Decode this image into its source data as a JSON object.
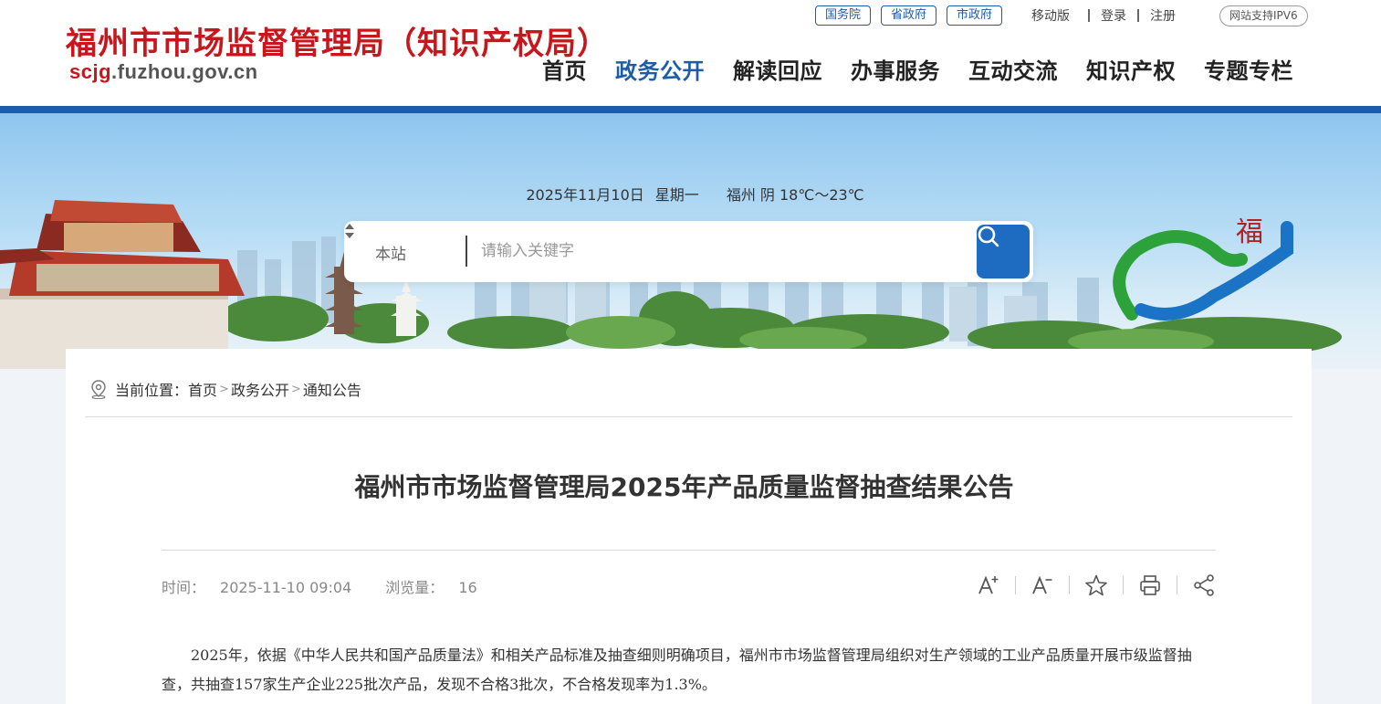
{
  "header": {
    "site_title": "福州市市场监督管理局（知识产权局）",
    "domain_prefix": "scjg",
    "domain_suffix": ".fuzhou.gov.cn",
    "gov_links": [
      "国务院",
      "省政府",
      "市政府"
    ],
    "util_links": [
      "移动版",
      "登录",
      "注册"
    ],
    "ipv6_badge": "网站支持IPV6",
    "nav": [
      {
        "label": "首页",
        "active": false
      },
      {
        "label": "政务公开",
        "active": true
      },
      {
        "label": "解读回应",
        "active": false
      },
      {
        "label": "办事服务",
        "active": false
      },
      {
        "label": "互动交流",
        "active": false
      },
      {
        "label": "知识产权",
        "active": false
      },
      {
        "label": "专题专栏",
        "active": false
      }
    ],
    "accent_color": "#1d5ca8",
    "title_color": "#c8161d"
  },
  "banner": {
    "date": "2025年11月10日",
    "weekday": "星期一",
    "weather": "福州 阴 18℃～23℃",
    "logo_glyph": "福"
  },
  "search": {
    "scope": "本站",
    "placeholder": "请输入关键字",
    "button_icon": "search-icon"
  },
  "breadcrumb": {
    "prefix": "当前位置：",
    "items": [
      "首页",
      "政务公开",
      "通知公告"
    ],
    "separator": ">"
  },
  "article": {
    "title": "福州市市场监督管理局2025年产品质量监督抽查结果公告",
    "time_label": "时间：",
    "time": "2025-11-10 09:04",
    "views_label": "浏览量：",
    "views": "16",
    "paragraph": "2025年，依据《中华人民共和国产品质量法》和相关产品标准及抽查细则明确项目，福州市市场监督管理局组织对生产领域的工业产品质量开展市级监督抽查，共抽查157家生产企业225批次产品，发现不合格3批次，不合格发现率为1.3%。"
  },
  "tools": [
    "font-increase-icon",
    "font-decrease-icon",
    "favorite-star-icon",
    "print-icon",
    "share-icon"
  ]
}
